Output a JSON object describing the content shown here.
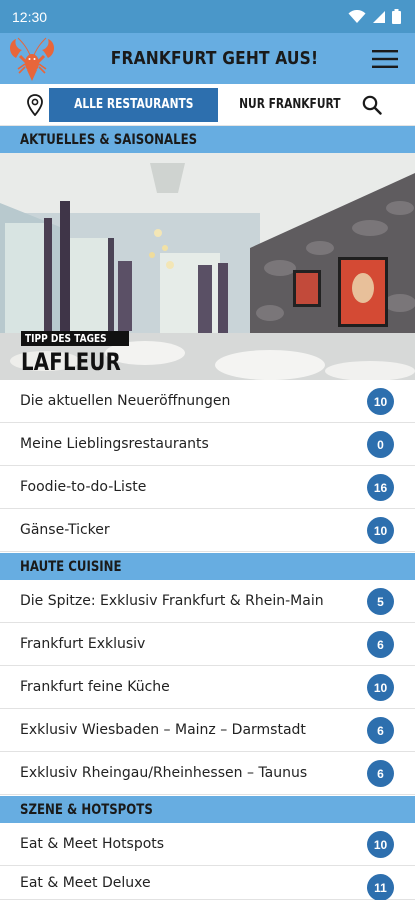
{
  "status_bar": {
    "time": "12:30",
    "icons": [
      "wifi-icon",
      "signal-icon",
      "battery-icon"
    ]
  },
  "app_bar": {
    "title": "FRANKFURT GEHT AUS!",
    "logo": "lobster-logo",
    "menu_icon": "hamburger-menu-icon"
  },
  "toolbar": {
    "map_icon": "location-pin-icon",
    "filter_all": "ALLE RESTAURANTS",
    "filter_frankfurt": "NUR FRANKFURT",
    "search_icon": "search-icon",
    "active_filter": "ALLE RESTAURANTS"
  },
  "sections": [
    {
      "title": "AKTUELLES & SAISONALES",
      "hero": {
        "badge": "TIPP DES TAGES",
        "title": "LAFLEUR"
      },
      "items": [
        {
          "label": "Die aktuellen Neueröffnungen",
          "count": "10"
        },
        {
          "label": "Meine Lieblingsrestaurants",
          "count": "0"
        },
        {
          "label": "Foodie-to-do-Liste",
          "count": "16"
        },
        {
          "label": "Gänse-Ticker",
          "count": "10"
        }
      ]
    },
    {
      "title": "HAUTE CUISINE",
      "items": [
        {
          "label": "Die Spitze: Exklusiv Frankfurt & Rhein-Main",
          "count": "5"
        },
        {
          "label": "Frankfurt Exklusiv",
          "count": "6"
        },
        {
          "label": "Frankfurt feine Küche",
          "count": "10"
        },
        {
          "label": "Exklusiv Wiesbaden – Mainz – Darmstadt",
          "count": "6"
        },
        {
          "label": "Exklusiv Rheingau/Rheinhessen – Taunus",
          "count": "6"
        }
      ]
    },
    {
      "title": "SZENE & HOTSPOTS",
      "items": [
        {
          "label": "Eat & Meet Hotspots",
          "count": "10"
        },
        {
          "label": "Eat & Meet Deluxe",
          "count": "11"
        }
      ]
    }
  ],
  "colors": {
    "status_bar": "#4a97c9",
    "app_bar": "#67ade1",
    "accent": "#2d6fae",
    "badge": "#2d6fae"
  }
}
